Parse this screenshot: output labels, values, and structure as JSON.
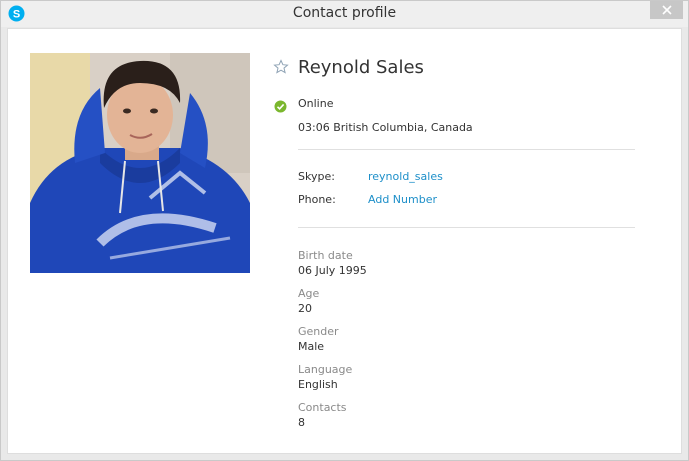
{
  "window": {
    "title": "Contact profile"
  },
  "profile": {
    "name": "Reynold Sales",
    "status": "Online",
    "local_time": "03:06 British Columbia, Canada",
    "skype_label": "Skype:",
    "skype_value": "reynold_sales",
    "phone_label": "Phone:",
    "phone_value": "Add Number",
    "details": [
      {
        "label": "Birth date",
        "value": "06 July 1995"
      },
      {
        "label": "Age",
        "value": "20"
      },
      {
        "label": "Gender",
        "value": "Male"
      },
      {
        "label": "Language",
        "value": "English"
      },
      {
        "label": "Contacts",
        "value": "8"
      }
    ]
  },
  "colors": {
    "accent": "#00aff0",
    "link": "#1d8fc9",
    "online": "#7bb72e"
  },
  "icons": {
    "app": "skype-icon",
    "close": "close-icon",
    "favorite": "star-icon",
    "status": "online-status-icon"
  }
}
